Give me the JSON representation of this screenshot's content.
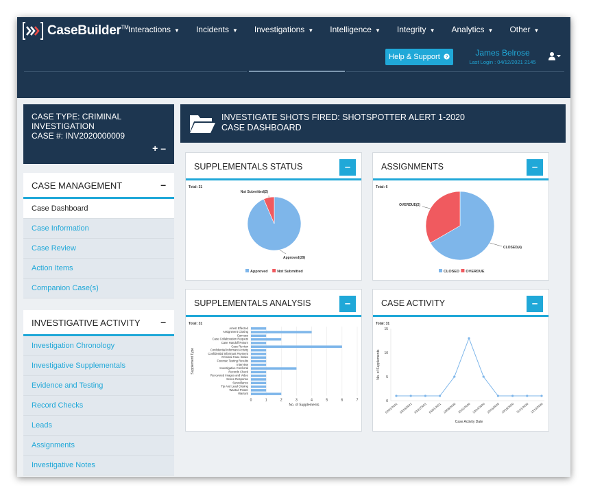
{
  "app": {
    "logo_text": "CaseBuilder",
    "logo_tm": "TM",
    "nav": [
      "Interactions",
      "Incidents",
      "Investigations",
      "Intelligence",
      "Integrity",
      "Analytics",
      "Other"
    ],
    "help_label": "Help & Support",
    "help_icon": "question-circle-icon",
    "user_name": "James Belrose",
    "last_login": "Last Login : 04/12/2021 2145"
  },
  "case": {
    "type_line1": "CASE TYPE: CRIMINAL",
    "type_line2": "INVESTIGATION",
    "number": "CASE #: INV2020000009",
    "expand_collapse": "+ –",
    "header_line1": "INVESTIGATE SHOTS FIRED: SHOTSPOTTER ALERT 1-2020",
    "header_line2": "CASE DASHBOARD"
  },
  "sidebar": {
    "case_management": {
      "title": "CASE MANAGEMENT",
      "toggle": "–",
      "items": [
        "Case Dashboard",
        "Case Information",
        "Case Review",
        "Action Items",
        "Companion Case(s)"
      ],
      "active_index": 0
    },
    "investigative_activity": {
      "title": "INVESTIGATIVE ACTIVITY",
      "toggle": "–",
      "items": [
        "Investigation Chronology",
        "Investigative Supplementals",
        "Evidence and Testing",
        "Record Checks",
        "Leads",
        "Assignments",
        "Investigative Notes"
      ]
    }
  },
  "cards": {
    "supplementals_status": "SUPPLEMENTALS STATUS",
    "assignments": "ASSIGNMENTS",
    "supplementals_analysis": "SUPPLEMENTALS ANALYSIS",
    "case_activity": "CASE ACTIVITY",
    "toggle": "–"
  },
  "colors": {
    "navy": "#1d3650",
    "accent": "#20a8d8",
    "blue_series": "#7eb6ea",
    "red_series": "#f05a5f"
  },
  "chart_data": [
    {
      "type": "pie",
      "total_label": "Total: 31",
      "slices": [
        {
          "name": "Approved",
          "value": 29,
          "color": "#7eb6ea",
          "label": "Approved(29)"
        },
        {
          "name": "Not Submitted",
          "value": 2,
          "color": "#f05a5f",
          "label": "Not Submitted(2)"
        }
      ],
      "legend": [
        "Approved",
        "Not Submitted"
      ],
      "legend_position": "bottom"
    },
    {
      "type": "pie",
      "total_label": "Total: 6",
      "slices": [
        {
          "name": "CLOSED",
          "value": 4,
          "color": "#7eb6ea",
          "label": "CLOSED(4)"
        },
        {
          "name": "OVERDUE",
          "value": 2,
          "color": "#f05a5f",
          "label": "OVERDUE(2)"
        }
      ],
      "legend": [
        "CLOSED",
        "OVERDUE"
      ],
      "legend_position": "bottom"
    },
    {
      "type": "bar",
      "orientation": "horizontal",
      "total_label": "Total: 31",
      "categories": [
        "Arrest Effected",
        "Assignment Closing",
        "Canvass",
        "Case Collaboration Request",
        "Case Handoff Return",
        "Case Review",
        "Confidential Informant Activity",
        "Confidential Informant Payment",
        "Criminal Case Intake",
        "Forensic Testing Results",
        "Interview",
        "Investigative Conferral",
        "Records Check",
        "Recovered Images and Video",
        "Scene Response",
        "Surveillance",
        "Tip And Lead Closing",
        "Wanted Poster",
        "Warrant"
      ],
      "values": [
        1,
        4,
        1,
        2,
        1,
        6,
        1,
        1,
        1,
        1,
        1,
        3,
        1,
        1,
        1,
        1,
        1,
        1,
        2
      ],
      "xlabel": "No. of Supplements",
      "ylabel": "Supplement Type",
      "xlim": [
        0,
        7
      ],
      "xticks": [
        "0",
        "1",
        "2",
        "3",
        "4",
        "5",
        "6",
        "7"
      ],
      "grid": true
    },
    {
      "type": "line",
      "total_label": "Total: 31",
      "x": [
        "02/01/2021",
        "03/18/2021",
        "03/22/2021",
        "04/01/2021",
        "10/08/2020",
        "10/11/2020",
        "10/14/2020",
        "10/16/2020",
        "10/18/2020",
        "11/11/2020",
        "11/13/2020"
      ],
      "values": [
        1,
        1,
        1,
        1,
        5,
        13,
        5,
        1,
        1,
        1,
        1
      ],
      "xlabel": "Case Activity Date",
      "ylabel": "No. of Supplements",
      "ylim": [
        0,
        15
      ],
      "yticks": [
        "0",
        "5",
        "10",
        "15"
      ]
    }
  ]
}
